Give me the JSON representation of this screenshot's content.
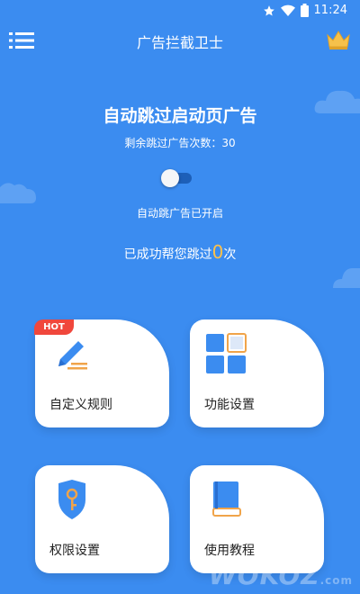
{
  "status_bar": {
    "time": "11:24",
    "icons": [
      "star-icon",
      "wifi-icon",
      "battery-icon"
    ]
  },
  "toolbar": {
    "title": "广告拦截卫士",
    "menu_icon": "hamburger-icon",
    "vip_icon": "crown-icon"
  },
  "hero": {
    "title": "自动跳过启动页广告",
    "remaining_label": "剩余跳过广告次数：30",
    "toggle_on": true,
    "status": "自动跳广告已开启",
    "skipped_prefix": "已成功帮您跳过",
    "skipped_count": "0",
    "skipped_suffix": "次"
  },
  "cards": [
    {
      "label": "自定义规则",
      "icon": "edit-rule-icon",
      "badge": "HOT"
    },
    {
      "label": "功能设置",
      "icon": "grid-settings-icon"
    },
    {
      "label": "权限设置",
      "icon": "key-shield-icon"
    },
    {
      "label": "使用教程",
      "icon": "book-icon"
    }
  ],
  "watermark": {
    "text": "WOKOZ",
    "suffix": ".com"
  },
  "colors": {
    "background": "#3b8cf0",
    "accent": "#ffc14a",
    "hot": "#f0473c",
    "icon_blue": "#3b8cf0"
  }
}
